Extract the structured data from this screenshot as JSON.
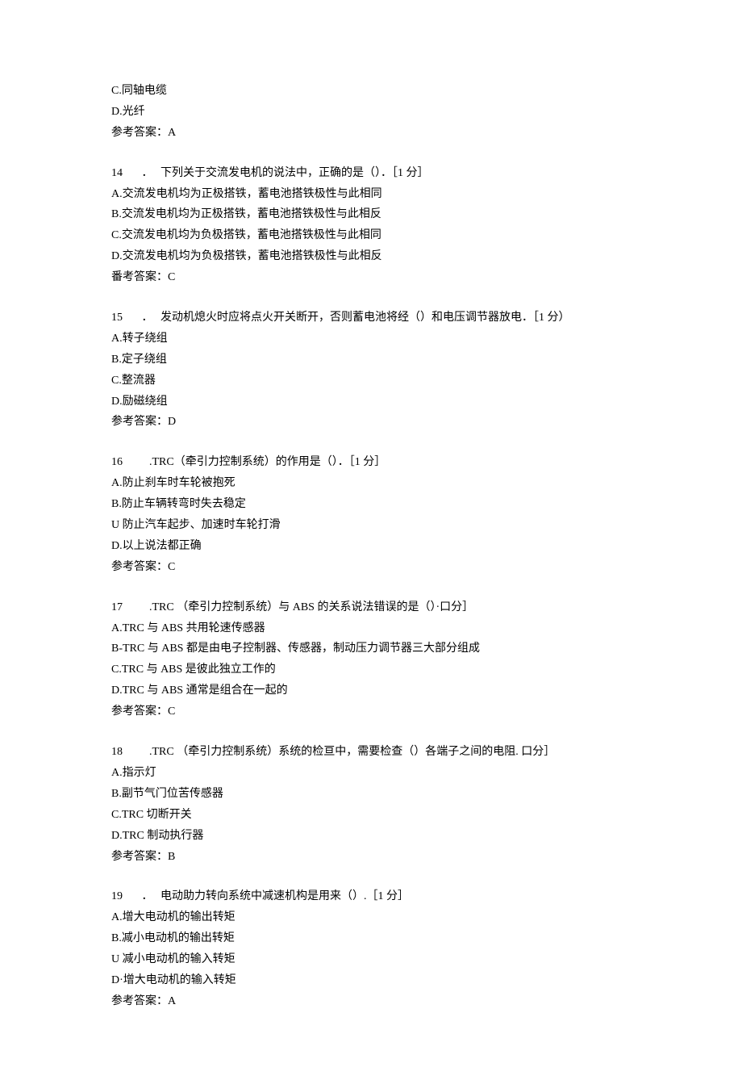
{
  "prefix": {
    "lines": [
      "C.同轴电缆",
      "D.光纤",
      "参考答案：A"
    ]
  },
  "questions": [
    {
      "num": "14",
      "dot": "．",
      "stem": "下列关于交流发电机的说法中，正确的是（）．［1 分］",
      "options": [
        "A.交流发电机均为正极搭铁，蓄电池搭铁极性与此相同",
        "B.交流发电机均为正极搭铁，蓄电池搭铁极性与此相反",
        "C.交流发电机均为负极搭铁，蓄电池搭铁极性与此相同",
        "D.交流发电机均为负极搭铁，蓄电池搭铁极性与此相反"
      ],
      "answer": "番考答案：C"
    },
    {
      "num": "15",
      "dot": "．",
      "stem": "发动机熄火时应将点火开关断开，否则蓄电池将经（）和电压调节器放电．［1 分）",
      "options": [
        "A.转子绕组",
        "B.定子绕组",
        "C.整流器",
        "D.励磁绕组"
      ],
      "answer": "参考答案：D"
    },
    {
      "num": "16",
      "dot": "",
      "stem": ".TRC（牵引力控制系统）的作用是（）．［1 分］",
      "options": [
        "A.防止刹车时车轮被抱死",
        "B.防止车辆转弯时失去稳定",
        "U 防止汽车起步、加速时车轮打滑",
        "D.以上说法都正确"
      ],
      "answer": "参考答案：C"
    },
    {
      "num": "17",
      "dot": "",
      "stem": ".TRC （牵引力控制系统）与 ABS 的关系说法错误的是（）·口分］",
      "options": [
        "A.TRC 与 ABS 共用轮速传感器",
        "B-TRC 与 ABS 都是由电子控制器、传感器，制动压力调节器三大部分组成",
        "C.TRC 与 ABS 是彼此独立工作的",
        "D.TRC 与 ABS 通常是组合在一起的"
      ],
      "answer": "参考答案：C"
    },
    {
      "num": "18",
      "dot": "",
      "stem": ".TRC （牵引力控制系统）系统的检亘中，需要检查（）各端子之间的电阻. 口分］",
      "options": [
        "A.指示灯",
        "B.副节气门位苦传感器",
        "C.TRC 切断开关",
        "D.TRC 制动执行器"
      ],
      "answer": "参考答案：B"
    },
    {
      "num": "19",
      "dot": "．",
      "stem": "电动助力转向系统中减速机构是用来（）.［1 分］",
      "options": [
        "A.增大电动机的输出转矩",
        "B.减小电动机的输出转矩",
        "U 减小电动机的输入转矩",
        "D·增大电动机的输入转矩"
      ],
      "answer": "参考答案：A"
    }
  ]
}
